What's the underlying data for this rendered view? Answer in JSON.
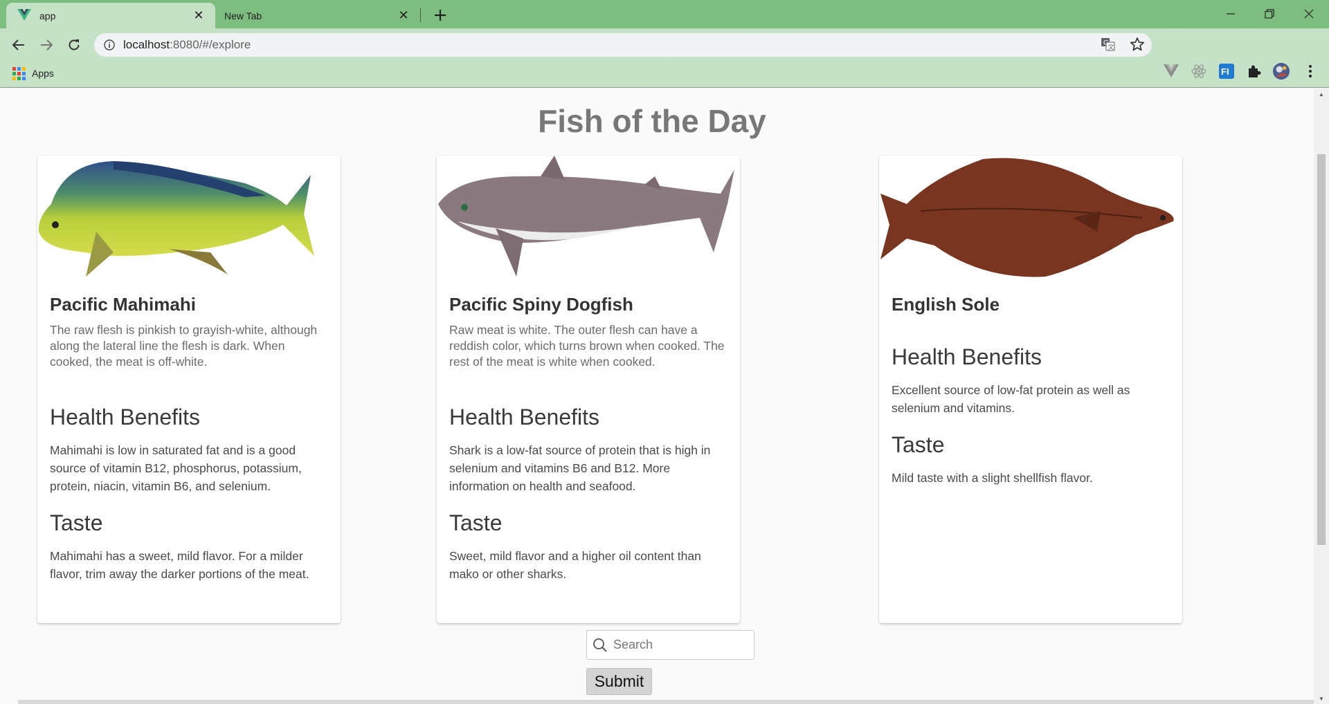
{
  "browser": {
    "tabs": [
      {
        "title": "app",
        "active": true
      },
      {
        "title": "New Tab",
        "active": false
      }
    ],
    "url_host": "localhost",
    "url_rest": ":8080/#/explore",
    "bookmarks": {
      "apps_label": "Apps"
    },
    "icons": [
      "back-icon",
      "forward-icon",
      "reload-icon",
      "info-icon",
      "translate-icon",
      "star-icon",
      "vue-extension-icon",
      "react-extension-icon",
      "fi-extension-icon",
      "puzzle-icon",
      "avatar",
      "menu-icon"
    ]
  },
  "page": {
    "title": "Fish of the Day",
    "cards": [
      {
        "name": "Pacific Mahimahi",
        "description": "The raw flesh is pinkish to grayish-white, although along the lateral line the flesh is dark. When cooked, the meat is off-white.",
        "health_heading": "Health Benefits",
        "health_text": "Mahimahi is low in saturated fat and is a good source of vitamin B12, phosphorus, potassium, protein, niacin, vitamin B6, and selenium.",
        "taste_heading": "Taste",
        "taste_text": "Mahimahi has a sweet, mild flavor. For a milder flavor, trim away the darker portions of the meat."
      },
      {
        "name": "Pacific Spiny Dogfish",
        "description": "Raw meat is white. The outer flesh can have a reddish color, which turns brown when cooked. The rest of the meat is white when cooked.",
        "health_heading": "Health Benefits",
        "health_text": "Shark is a low-fat source of protein that is high in selenium and vitamins B6 and B12. More information on health and seafood.",
        "taste_heading": "Taste",
        "taste_text": "Sweet, mild flavor and a higher oil content than mako or other sharks."
      },
      {
        "name": "English Sole",
        "description": "",
        "health_heading": "Health Benefits",
        "health_text": "Excellent source of low-fat protein as well as selenium and vitamins.",
        "taste_heading": "Taste",
        "taste_text": "Mild taste with a slight shellfish flavor."
      }
    ],
    "search": {
      "placeholder": "Search",
      "value": ""
    },
    "submit_label": "Submit"
  },
  "colors": {
    "tab_strip": "#7dbd7f",
    "toolbar": "#c5e2c6",
    "page_bg": "#fafafa",
    "title": "#777777"
  }
}
